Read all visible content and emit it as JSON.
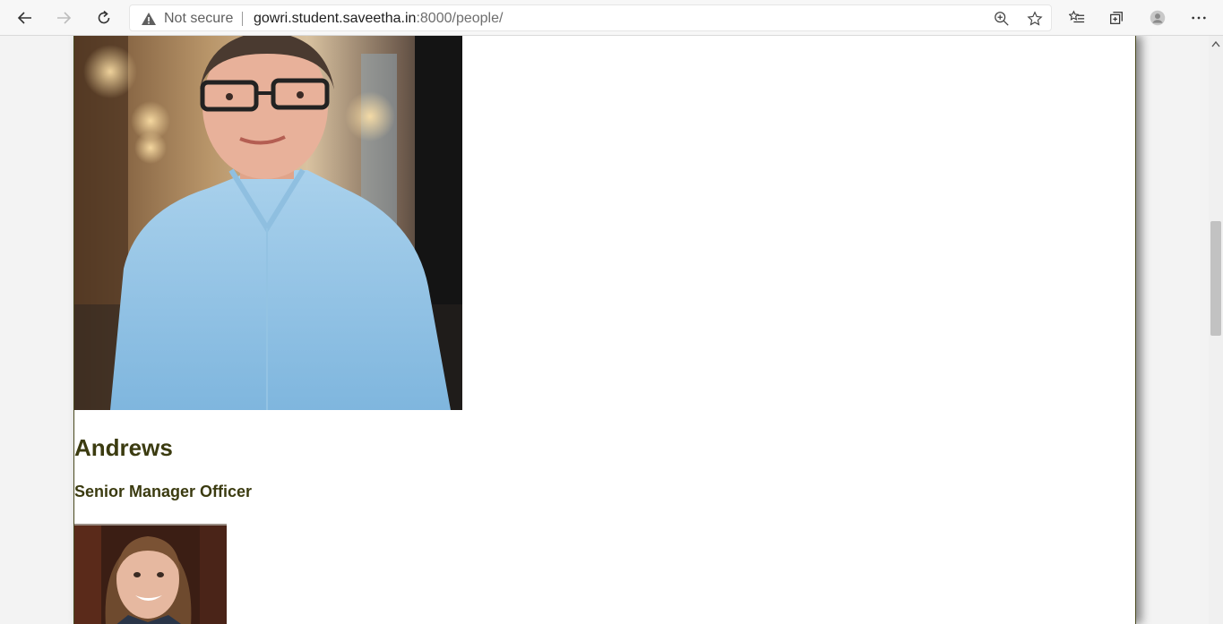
{
  "browser": {
    "security_label": "Not secure",
    "url_host": "gowri.student.saveetha.in",
    "url_path": ":8000/people/",
    "icons": {
      "back": "back-arrow-icon",
      "forward": "forward-arrow-icon",
      "refresh": "refresh-icon",
      "warning": "warning-icon",
      "zoom": "zoom-icon",
      "favorite": "star-icon",
      "favorites_list": "favorites-icon",
      "collections": "collections-icon",
      "profile": "profile-icon",
      "menu": "more-icon"
    }
  },
  "people": [
    {
      "name": "Andrews",
      "role": "Senior Manager Officer"
    }
  ],
  "colors": {
    "heading": "#3b3b10",
    "page_border": "#4a4a20"
  }
}
